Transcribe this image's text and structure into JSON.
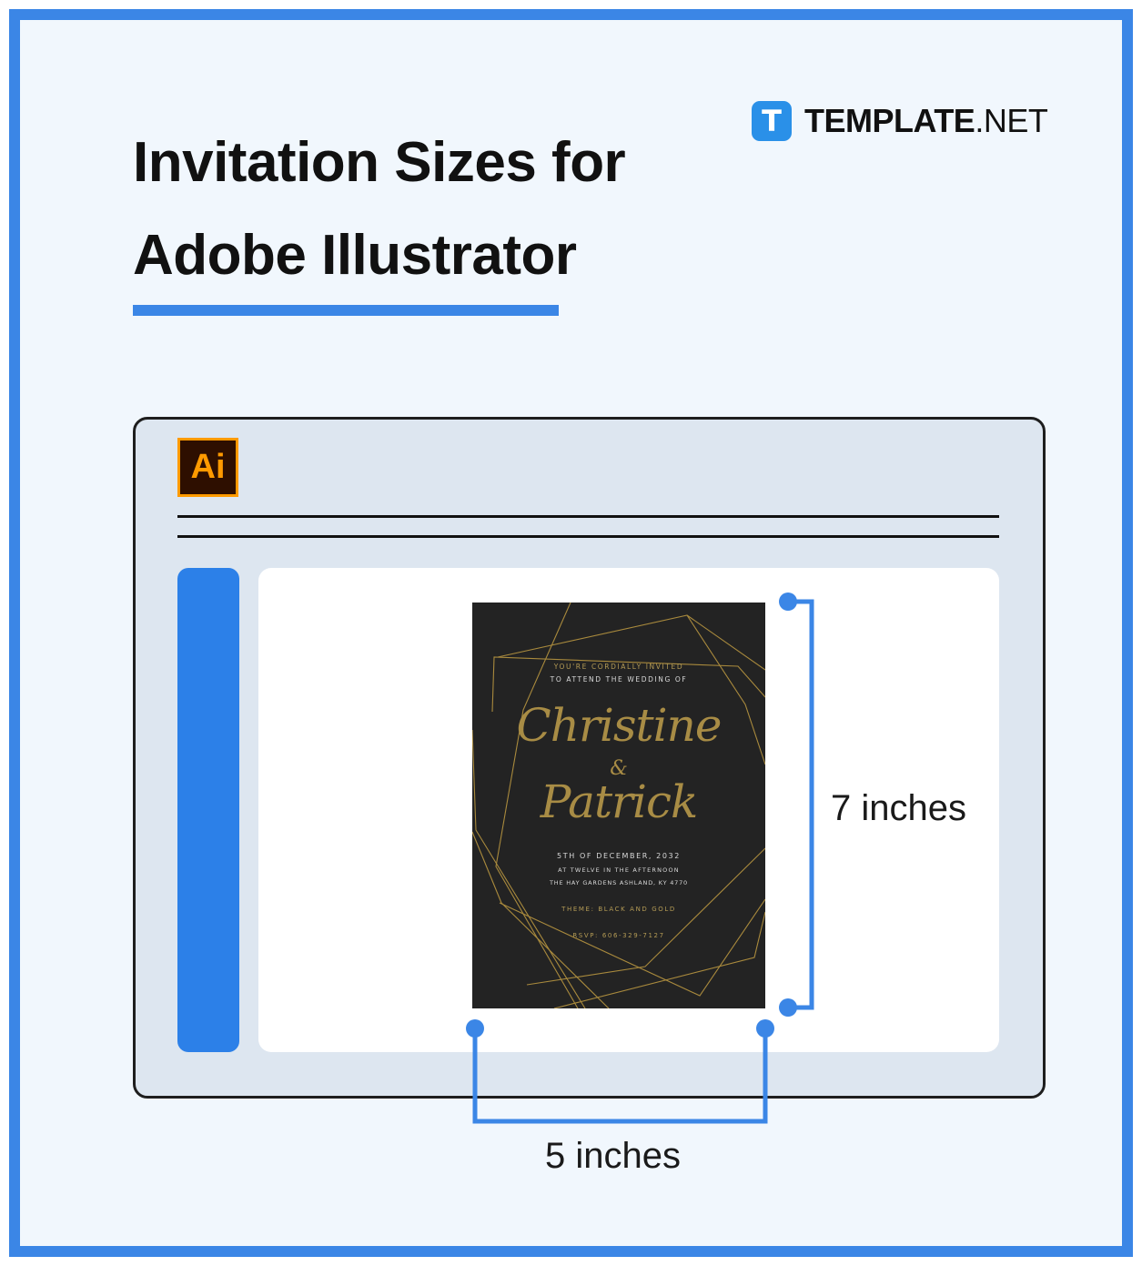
{
  "title": {
    "line1": "Invitation Sizes for",
    "line2": "Adobe Illustrator"
  },
  "brand": {
    "icon_letter": "T",
    "name_bold": "TEMPLATE",
    "name_suffix": ".NET"
  },
  "app": {
    "logo": "Ai"
  },
  "invitation": {
    "line1": "YOU'RE CORDIALLY INVITED",
    "line2": "TO ATTEND THE WEDDING OF",
    "name1": "Christine",
    "ampersand": "&",
    "name2": "Patrick",
    "date": "5TH OF DECEMBER, 2032",
    "time": "AT TWELVE IN THE AFTERNOON",
    "venue": "THE HAY GARDENS ASHLAND, KY 4770",
    "theme": "THEME: BLACK AND GOLD",
    "rsvp": "RSVP: 606-329-7127"
  },
  "dimensions": {
    "height": "7 inches",
    "width": "5 inches"
  },
  "colors": {
    "accent": "#3b86e6",
    "background": "#f1f7fd",
    "window": "#dde6f0",
    "card": "#232323",
    "gold": "#b49b55"
  }
}
